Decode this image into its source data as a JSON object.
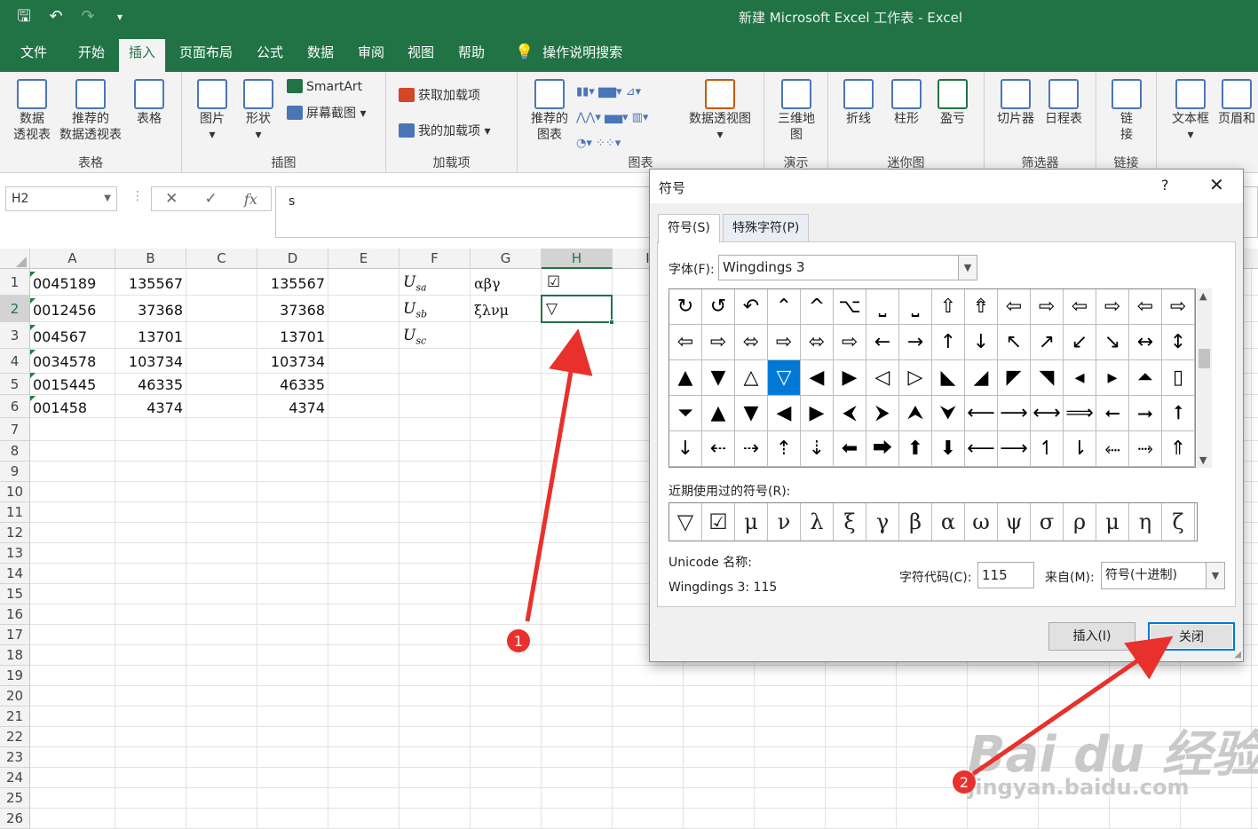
{
  "window": {
    "title": "新建 Microsoft Excel 工作表 - Excel",
    "qat": [
      "save-icon",
      "undo-icon",
      "redo-icon",
      "customize-icon"
    ]
  },
  "menu": {
    "tabs": [
      "文件",
      "开始",
      "插入",
      "页面布局",
      "公式",
      "数据",
      "审阅",
      "视图",
      "帮助"
    ],
    "active": "插入",
    "tellme": "操作说明搜索"
  },
  "ribbon": {
    "groups": {
      "tables": {
        "label": "表格",
        "pivot": "数据\n透视表",
        "recommended_pivot": "推荐的\n数据透视表",
        "table": "表格"
      },
      "illustrations": {
        "label": "插图",
        "pictures": "图片",
        "shapes": "形状",
        "smartart": "SmartArt",
        "screenshot": "屏幕截图"
      },
      "addins": {
        "label": "加载项",
        "get_addins": "获取加载项",
        "my_addins": "我的加载项"
      },
      "charts": {
        "label": "图表",
        "recommended_charts": "推荐的\n图表",
        "pivot_chart": "数据透视图"
      },
      "tours": {
        "label": "演示",
        "map3d": "三维地\n图"
      },
      "sparklines": {
        "label": "迷你图",
        "line": "折线",
        "column": "柱形",
        "winloss": "盈亏"
      },
      "filters": {
        "label": "筛选器",
        "slicer": "切片器",
        "timeline": "日程表"
      },
      "links": {
        "label": "链接",
        "link": "链\n接"
      },
      "text": {
        "textbox": "文本框",
        "header_footer": "页眉和"
      }
    }
  },
  "formula_bar": {
    "name_box": "H2",
    "content": "s"
  },
  "sheet": {
    "columns": [
      "A",
      "B",
      "C",
      "D",
      "E",
      "F",
      "G",
      "H",
      "I"
    ],
    "rows": [
      "1",
      "2",
      "3",
      "4",
      "5",
      "6",
      "7",
      "8",
      "9",
      "10",
      "11",
      "12",
      "13",
      "14",
      "15",
      "16",
      "17",
      "18",
      "19",
      "20",
      "21",
      "22",
      "23",
      "24",
      "25",
      "26"
    ],
    "selected_col": "H",
    "selected_row": "2",
    "col_a": [
      "0045189",
      "0012456",
      "004567",
      "0034578",
      "0015445",
      "001458"
    ],
    "col_b": [
      "135567",
      "37368",
      "13701",
      "103734",
      "46335",
      "4374"
    ],
    "col_d": [
      "135567",
      "37368",
      "13701",
      "103734",
      "46335",
      "4374"
    ],
    "col_f": [
      {
        "base": "U",
        "sub": "sa"
      },
      {
        "base": "U",
        "sub": "sb"
      },
      {
        "base": "U",
        "sub": "sc"
      }
    ],
    "col_g": [
      "αβγ",
      "ξλνμ"
    ],
    "col_h": [
      "☑",
      "▽"
    ]
  },
  "dialog": {
    "title": "符号",
    "help": "?",
    "close_x": "✕",
    "tabs": [
      "符号(S)",
      "特殊字符(P)"
    ],
    "font_label": "字体(F):",
    "font_value": "Wingdings 3",
    "symbols": [
      [
        "↻",
        "↺",
        "↶",
        "⌃",
        "^",
        "⌥",
        "⎵",
        "⎵",
        "⇧",
        "⇮",
        "⇦",
        "⇨",
        "⇦",
        "⇨",
        "⇦",
        "⇨"
      ],
      [
        "⇦",
        "⇨",
        "⬄",
        "⇨",
        "⬄",
        "⇨",
        "←",
        "→",
        "↑",
        "↓",
        "↖",
        "↗",
        "↙",
        "↘",
        "↔",
        "↕"
      ],
      [
        "▲",
        "▼",
        "△",
        "▽",
        "◀",
        "▶",
        "◁",
        "▷",
        "◣",
        "◢",
        "◤",
        "◥",
        "◂",
        "▸",
        "⏶",
        "▯"
      ],
      [
        "⏷",
        "▲",
        "▼",
        "◀",
        "▶",
        "⮜",
        "⮞",
        "⮝",
        "⮟",
        "⟵",
        "⟶",
        "⟷",
        "⟹",
        "⭠",
        "⭢",
        "⭡"
      ],
      [
        "↓",
        "⇠",
        "⇢",
        "⇡",
        "⇣",
        "⬅",
        "⮕",
        "⬆",
        "⬇",
        "⟵",
        "⟶",
        "↿",
        "⇂",
        "⬸",
        "⤑",
        "⇑"
      ]
    ],
    "selected_symbol": "▽",
    "recent_label": "近期使用过的符号(R):",
    "recent": [
      "▽",
      "☑",
      "μ",
      "ν",
      "λ",
      "ξ",
      "γ",
      "β",
      "α",
      "ω",
      "ψ",
      "σ",
      "ρ",
      "μ",
      "η",
      "ζ"
    ],
    "unicode_label": "Unicode 名称:",
    "unicode_value": "Wingdings 3: 115",
    "code_label": "字符代码(C):",
    "code_value": "115",
    "from_label": "来自(M):",
    "from_value": "符号(十进制)",
    "insert_button": "插入(I)",
    "close_button": "关闭"
  },
  "annotations": {
    "marker1": "1",
    "marker2": "2",
    "color": "#e8312c"
  },
  "watermark": {
    "logo": "Bai du 经验",
    "url": "jingyan.baidu.com"
  }
}
